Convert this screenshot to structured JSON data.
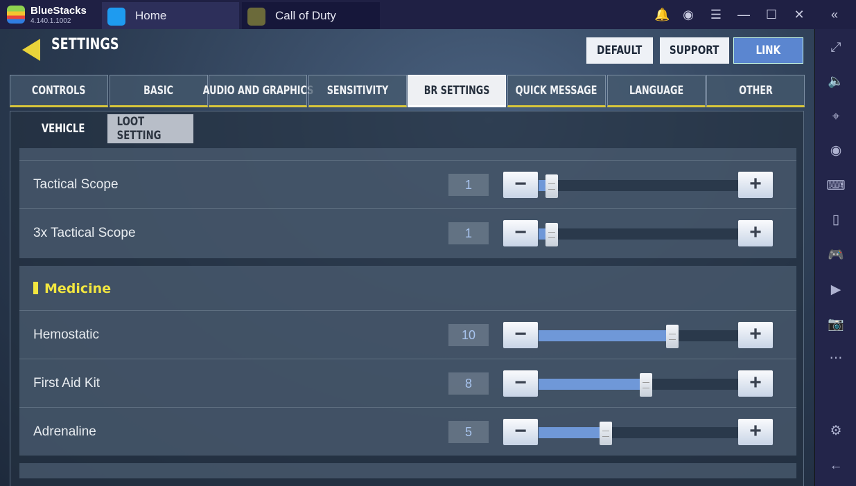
{
  "app": {
    "name": "BlueStacks",
    "version": "4.140.1.1002"
  },
  "tabs": [
    {
      "label": "Home",
      "icon": "home-icon"
    },
    {
      "label": "Call of Duty",
      "icon": "call-of-duty-icon"
    }
  ],
  "sidebar_icons": [
    "fullscreen-icon",
    "mute-icon",
    "cursor-lock-icon",
    "eye-icon",
    "keyboard-icon",
    "rotate-icon",
    "gamepad-icon",
    "media-icon",
    "camera-icon",
    "more-icon",
    "settings-icon",
    "back-icon"
  ],
  "settings": {
    "title": "SETTINGS",
    "buttons": {
      "default": "DEFAULT",
      "support": "SUPPORT",
      "link": "LINK"
    },
    "tabs": [
      "CONTROLS",
      "BASIC",
      "AUDIO AND GRAPHICS",
      "SENSITIVITY",
      "BR SETTINGS",
      "QUICK MESSAGE",
      "LANGUAGE",
      "OTHER"
    ],
    "active_tab": "BR SETTINGS",
    "subtabs": [
      "VEHICLE",
      "LOOT SETTING"
    ],
    "active_subtab": "LOOT SETTING",
    "rows": [
      {
        "label": "Tactical Scope",
        "value": "1",
        "fraction": 0.067
      },
      {
        "label": "3x Tactical Scope",
        "value": "1",
        "fraction": 0.067
      }
    ],
    "section": "Medicine",
    "medicine_rows": [
      {
        "label": "Hemostatic",
        "value": "10",
        "fraction": 0.667
      },
      {
        "label": "First Aid Kit",
        "value": "8",
        "fraction": 0.533
      },
      {
        "label": "Adrenaline",
        "value": "5",
        "fraction": 0.333
      }
    ],
    "minus": "−",
    "plus": "+"
  },
  "colors": {
    "accent_yellow": "#f2e640",
    "slider_fill": "#6f98d8",
    "link_button": "#5b86d0"
  }
}
